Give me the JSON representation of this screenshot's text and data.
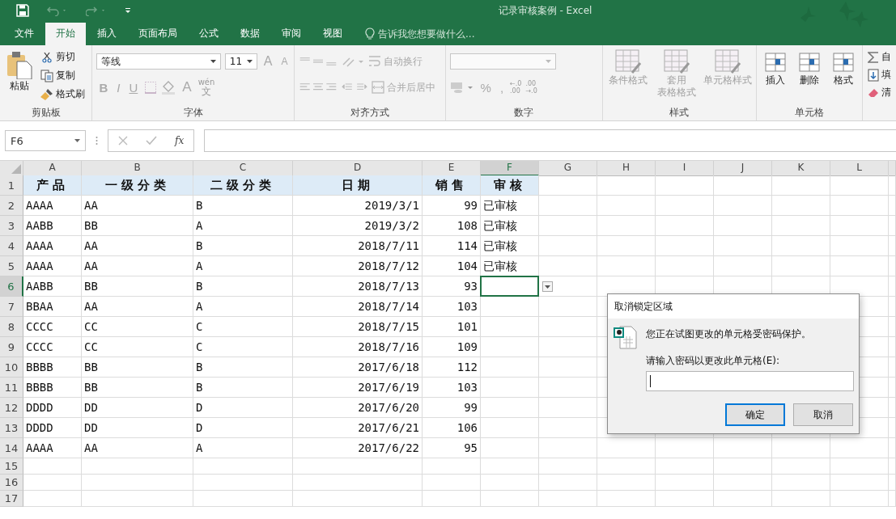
{
  "window": {
    "title": "记录审核案例 - Excel"
  },
  "tabs": [
    {
      "label": "文件",
      "selected": false
    },
    {
      "label": "开始",
      "selected": true
    },
    {
      "label": "插入",
      "selected": false
    },
    {
      "label": "页面布局",
      "selected": false
    },
    {
      "label": "公式",
      "selected": false
    },
    {
      "label": "数据",
      "selected": false
    },
    {
      "label": "审阅",
      "selected": false
    },
    {
      "label": "视图",
      "selected": false
    }
  ],
  "tell_me": {
    "placeholder": "告诉我您想要做什么..."
  },
  "ribbon": {
    "clipboard": {
      "label": "剪贴板",
      "paste": "粘贴",
      "cut": "剪切",
      "copy": "复制",
      "format_painter": "格式刷"
    },
    "font": {
      "label": "字体",
      "font_name": "等线",
      "font_size": "11",
      "grow": "A",
      "shrink": "A",
      "bold": "B",
      "italic": "I",
      "underline": "U",
      "font_color": "A",
      "phonetic_top": "wén",
      "phonetic_bottom": "文"
    },
    "alignment": {
      "label": "对齐方式",
      "buttons": [
        {
          "label": "自动换行",
          "disabled": true
        },
        {
          "label": "合并后居中",
          "disabled": true
        }
      ]
    },
    "number": {
      "label": "数字",
      "percent": "%",
      "comma": ",",
      "increase": [
        "←.0",
        ".00"
      ],
      "decrease": [
        ".00",
        "→.0"
      ]
    },
    "styles": {
      "label": "样式",
      "buttons": [
        {
          "lines": [
            "条件格式"
          ],
          "disabled": true
        },
        {
          "lines": [
            "套用",
            "表格格式"
          ],
          "disabled": true
        },
        {
          "lines": [
            "单元格样式"
          ],
          "disabled": true
        }
      ]
    },
    "cells": {
      "label": "单元格",
      "buttons": [
        {
          "lines": [
            "插入"
          ],
          "disabled": false
        },
        {
          "lines": [
            "删除"
          ],
          "disabled": false
        },
        {
          "lines": [
            "格式"
          ],
          "disabled": false
        }
      ]
    },
    "editing": [
      "自",
      "填",
      "清"
    ]
  },
  "formula_bar": {
    "name_box": "F6",
    "fx": "fx"
  },
  "sheet": {
    "columns": [
      {
        "label": "A",
        "selected": false
      },
      {
        "label": "B",
        "selected": false
      },
      {
        "label": "C",
        "selected": false
      },
      {
        "label": "D",
        "selected": false
      },
      {
        "label": "E",
        "selected": false
      },
      {
        "label": "F",
        "selected": true
      },
      {
        "label": "G",
        "selected": false
      },
      {
        "label": "H",
        "selected": false
      },
      {
        "label": "I",
        "selected": false
      },
      {
        "label": "J",
        "selected": false
      },
      {
        "label": "K",
        "selected": false
      },
      {
        "label": "L",
        "selected": false
      }
    ],
    "rows": [
      {
        "header": "1",
        "kind": "header",
        "selected": false,
        "cells": [
          "产品",
          "一级分类",
          "二级分类",
          "日期",
          "销售",
          "审核"
        ]
      },
      {
        "header": "2",
        "kind": "data",
        "selected": false,
        "cells": [
          "AAAA",
          "AA",
          "B",
          "2019/3/1",
          "99",
          "已审核"
        ]
      },
      {
        "header": "3",
        "kind": "data",
        "selected": false,
        "cells": [
          "AABB",
          "BB",
          "A",
          "2019/3/2",
          "108",
          "已审核"
        ]
      },
      {
        "header": "4",
        "kind": "data",
        "selected": false,
        "cells": [
          "AAAA",
          "AA",
          "B",
          "2018/7/11",
          "114",
          "已审核"
        ]
      },
      {
        "header": "5",
        "kind": "data",
        "selected": false,
        "cells": [
          "AAAA",
          "AA",
          "A",
          "2018/7/12",
          "104",
          "已审核"
        ]
      },
      {
        "header": "6",
        "kind": "data",
        "selected": true,
        "dropdown": true,
        "cells": [
          "AABB",
          "BB",
          "B",
          "2018/7/13",
          "93"
        ]
      },
      {
        "header": "7",
        "kind": "data",
        "selected": false,
        "cells": [
          "BBAA",
          "AA",
          "A",
          "2018/7/14",
          "103"
        ]
      },
      {
        "header": "8",
        "kind": "data",
        "selected": false,
        "cells": [
          "CCCC",
          "CC",
          "C",
          "2018/7/15",
          "101"
        ]
      },
      {
        "header": "9",
        "kind": "data",
        "selected": false,
        "cells": [
          "CCCC",
          "CC",
          "C",
          "2018/7/16",
          "109"
        ]
      },
      {
        "header": "10",
        "kind": "data",
        "selected": false,
        "cells": [
          "BBBB",
          "BB",
          "B",
          "2017/6/18",
          "112"
        ]
      },
      {
        "header": "11",
        "kind": "data",
        "selected": false,
        "cells": [
          "BBBB",
          "BB",
          "B",
          "2017/6/19",
          "103"
        ]
      },
      {
        "header": "12",
        "kind": "data",
        "selected": false,
        "cells": [
          "DDDD",
          "DD",
          "D",
          "2017/6/20",
          "99"
        ]
      },
      {
        "header": "13",
        "kind": "data",
        "selected": false,
        "cells": [
          "DDDD",
          "DD",
          "D",
          "2017/6/21",
          "106"
        ]
      },
      {
        "header": "14",
        "kind": "data",
        "selected": false,
        "cells": [
          "AAAA",
          "AA",
          "A",
          "2017/6/22",
          "95"
        ]
      },
      {
        "header": "15",
        "kind": "empty",
        "selected": false
      },
      {
        "header": "16",
        "kind": "empty",
        "selected": false
      },
      {
        "header": "17",
        "kind": "empty",
        "selected": false
      }
    ]
  },
  "dialog": {
    "title": "取消锁定区域",
    "message": "您正在试图更改的单元格受密码保护。",
    "prompt": "请输入密码以更改此单元格(E):",
    "buttons": [
      {
        "label": "确定",
        "default": true
      },
      {
        "label": "取消",
        "default": false
      }
    ]
  }
}
